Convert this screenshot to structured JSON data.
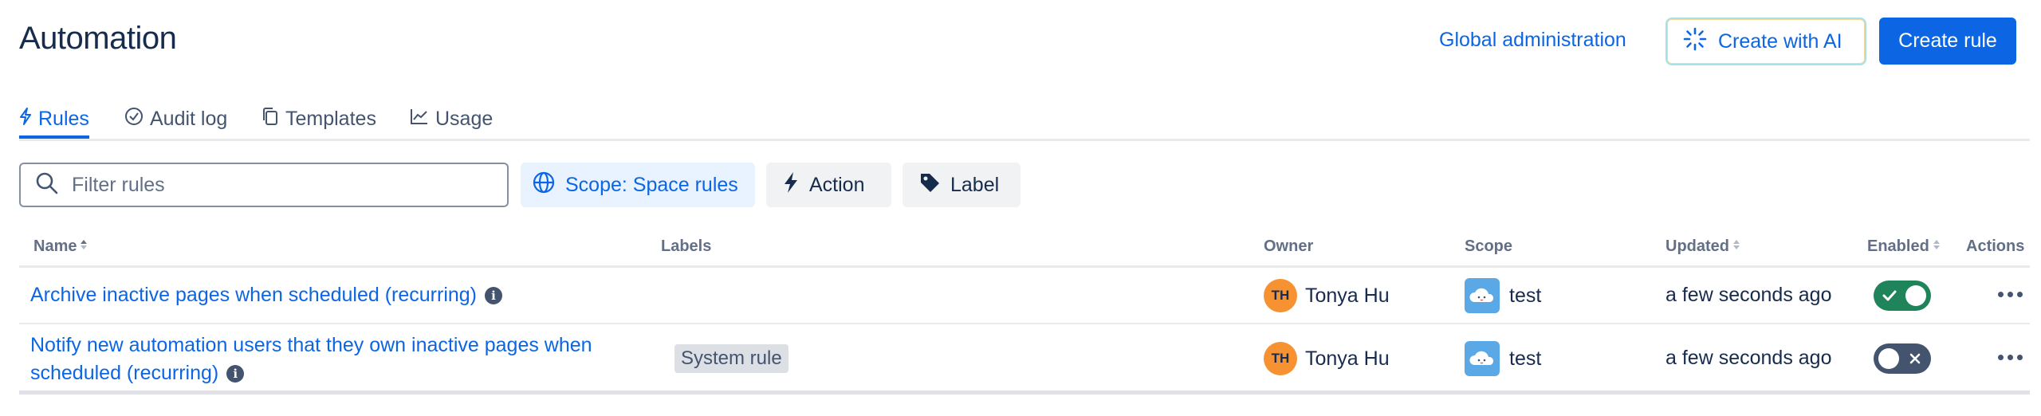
{
  "header": {
    "title": "Automation",
    "global_admin_label": "Global administration",
    "create_ai_label": "Create with AI",
    "create_rule_label": "Create rule"
  },
  "tabs": [
    {
      "label": "Rules",
      "icon": "lightning-icon",
      "active": true
    },
    {
      "label": "Audit log",
      "icon": "check-circle-icon",
      "active": false
    },
    {
      "label": "Templates",
      "icon": "copy-icon",
      "active": false
    },
    {
      "label": "Usage",
      "icon": "chart-line-icon",
      "active": false
    }
  ],
  "filters": {
    "search_placeholder": "Filter rules",
    "scope_label": "Scope: Space rules",
    "action_label": "Action",
    "label_label": "Label"
  },
  "table": {
    "columns": [
      "Name",
      "Labels",
      "Owner",
      "Scope",
      "Updated",
      "Enabled",
      "Actions"
    ],
    "rows": [
      {
        "name_line1": "Archive inactive pages when scheduled (recurring)",
        "name_line2": "",
        "label": "",
        "owner_initials": "TH",
        "owner_name": "Tonya Hu",
        "scope": "test",
        "updated": "a few seconds ago",
        "enabled": true
      },
      {
        "name_line1": "Notify new automation users that they own inactive pages when",
        "name_line2": "scheduled (recurring)",
        "label": "System rule",
        "owner_initials": "TH",
        "owner_name": "Tonya Hu",
        "scope": "test",
        "updated": "a few seconds ago",
        "enabled": false
      }
    ]
  },
  "colors": {
    "accent": "#0c66e4",
    "toggle_on": "#1f845a",
    "toggle_off": "#44546f",
    "avatar": "#f79232"
  }
}
